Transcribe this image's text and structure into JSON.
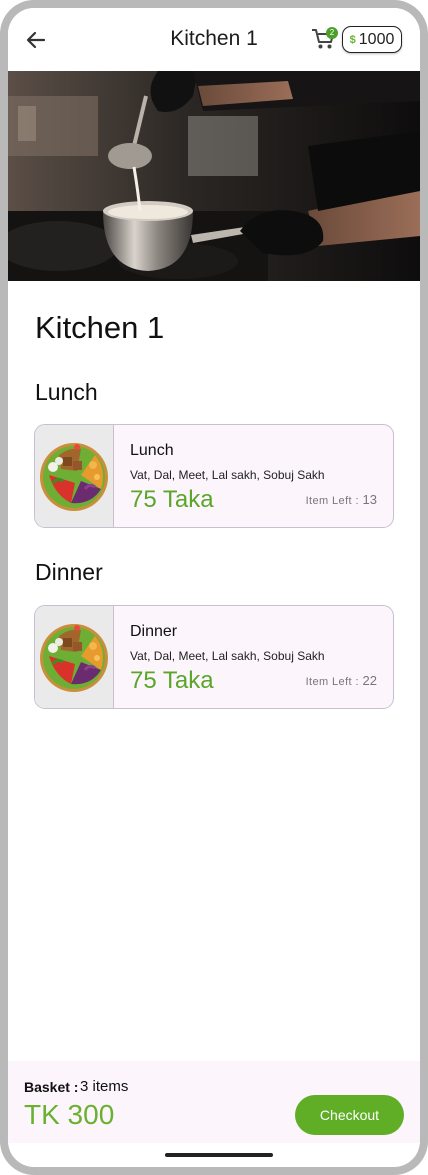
{
  "header": {
    "title": "Kitchen 1",
    "back_icon": "arrow-left-icon",
    "cart_icon": "cart-icon",
    "cart_badge": "2",
    "coin_icon": "coin-icon",
    "coin_symbol": "$",
    "coin_balance": "1000"
  },
  "hero": {
    "image": "chef-cooking-photo"
  },
  "page": {
    "title": "Kitchen 1"
  },
  "sections": [
    {
      "title": "Lunch",
      "item": {
        "name": "Lunch",
        "description": "Vat, Dal, Meet, Lal sakh, Sobuj Sakh",
        "price": "75 Taka",
        "items_left_label": "Item Left :",
        "items_left_value": "13",
        "image": "salad-bowl-photo"
      }
    },
    {
      "title": "Dinner",
      "item": {
        "name": "Dinner",
        "description": "Vat, Dal, Meet, Lal sakh, Sobuj Sakh",
        "price": "75 Taka",
        "items_left_label": "Item Left :",
        "items_left_value": "22",
        "image": "salad-bowl-photo"
      }
    }
  ],
  "basket": {
    "label": "Basket :",
    "count": "3 items",
    "total": "TK 300",
    "checkout_label": "Checkout"
  },
  "colors": {
    "accent_green": "#5fae25",
    "card_background": "#fdf5fc",
    "card_border": "#c9bfd0"
  }
}
